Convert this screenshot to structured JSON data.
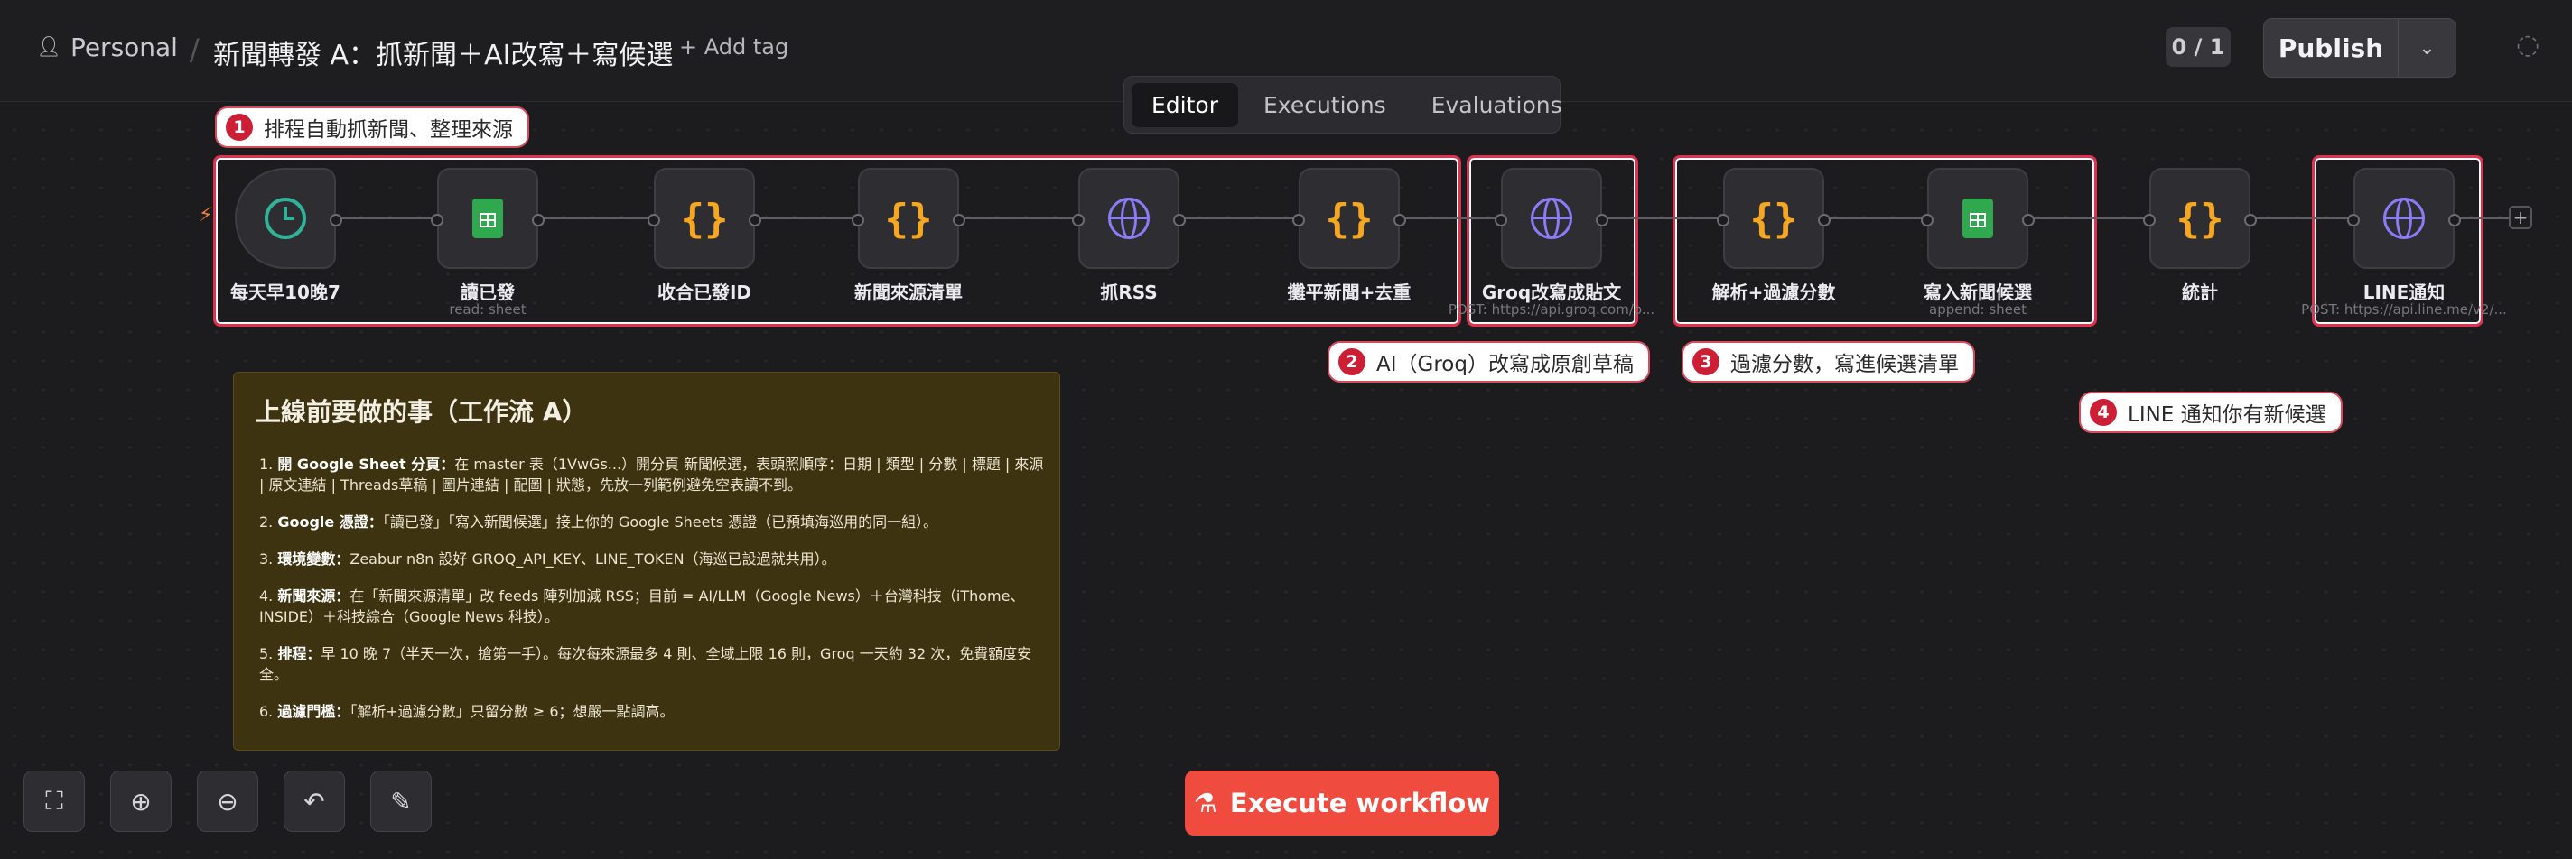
{
  "header": {
    "workspace": "Personal",
    "workflow_title": "新聞轉發 A：抓新聞＋AI改寫＋寫候選",
    "add_tag": "+ Add tag",
    "counter": "0 / 1",
    "publish_label": "Publish"
  },
  "tabs": [
    "Editor",
    "Executions",
    "Evaluations"
  ],
  "active_tab": "Editor",
  "annotations": [
    {
      "num": "1",
      "text": "排程自動抓新聞、整理來源"
    },
    {
      "num": "2",
      "text": "AI（Groq）改寫成原創草稿"
    },
    {
      "num": "3",
      "text": "過濾分數，寫進候選清單"
    },
    {
      "num": "4",
      "text": "LINE 通知你有新候選"
    }
  ],
  "nodes": [
    {
      "label": "每天早10晚7",
      "sub": "",
      "icon": "clock-icon"
    },
    {
      "label": "讀已發",
      "sub": "read: sheet",
      "icon": "sheets-icon"
    },
    {
      "label": "收合已發ID",
      "sub": "",
      "icon": "code-icon"
    },
    {
      "label": "新聞來源清單",
      "sub": "",
      "icon": "code-icon"
    },
    {
      "label": "抓RSS",
      "sub": "",
      "icon": "globe-icon"
    },
    {
      "label": "攤平新聞+去重",
      "sub": "",
      "icon": "code-icon"
    },
    {
      "label": "Groq改寫成貼文",
      "sub": "POST: https://api.groq.com/o...",
      "icon": "globe-icon"
    },
    {
      "label": "解析+過濾分數",
      "sub": "",
      "icon": "code-icon"
    },
    {
      "label": "寫入新聞候選",
      "sub": "append: sheet",
      "icon": "sheets-icon"
    },
    {
      "label": "統計",
      "sub": "",
      "icon": "code-icon"
    },
    {
      "label": "LINE通知",
      "sub": "POST: https://api.line.me/v2/...",
      "icon": "globe-icon"
    }
  ],
  "sticky": {
    "title": "上線前要做的事（工作流 A）",
    "items": [
      {
        "num": "1. ",
        "lead": "開 Google Sheet 分頁：",
        "text": "在 master 表（1VwGs...）開分頁 新聞候選，表頭照順序：日期 | 類型 | 分數 | 標題 | 來源 | 原文連結 | Threads草稿 | 圖片連結 | 配圖 | 狀態，先放一列範例避免空表讀不到。"
      },
      {
        "num": "2. ",
        "lead": "Google 憑證：",
        "text": "「讀已發」「寫入新聞候選」接上你的 Google Sheets 憑證（已預填海巡用的同一組）。"
      },
      {
        "num": "3. ",
        "lead": "環境變數：",
        "text": "Zeabur n8n 設好 GROQ_API_KEY、LINE_TOKEN（海巡已設過就共用）。"
      },
      {
        "num": "4. ",
        "lead": "新聞來源：",
        "text": "在「新聞來源清單」改 feeds 陣列加減 RSS；目前 = AI/LLM（Google News）＋台灣科技（iThome、INSIDE）＋科技綜合（Google News 科技）。"
      },
      {
        "num": "5. ",
        "lead": "排程：",
        "text": "早 10 晚 7（半天一次，搶第一手）。每次每來源最多 4 則、全域上限 16 則，Groq 一天約 32 次，免費額度安全。"
      },
      {
        "num": "6. ",
        "lead": "過濾門檻：",
        "text": "「解析+過濾分數」只留分數 ≥ 6；想嚴一點調高。"
      }
    ]
  },
  "execute_label": "Execute workflow",
  "colors": {
    "accent": "#ef4b3f",
    "annotation_border": "#e0324e",
    "sticky_bg": "#3d3310"
  }
}
